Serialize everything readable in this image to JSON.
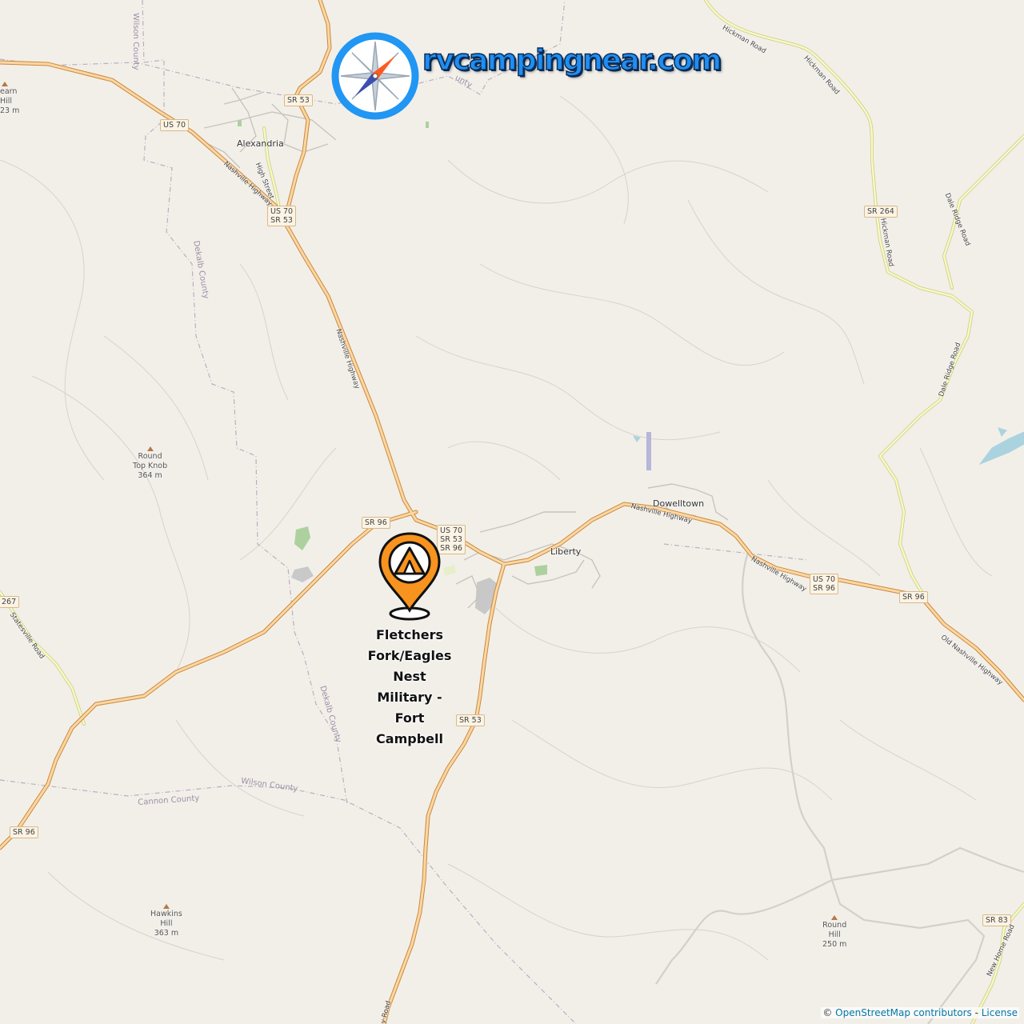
{
  "brand": {
    "text": "rvcampingnear.com",
    "icon": "compass-icon"
  },
  "marker": {
    "icon": "campground-pin-icon",
    "label_lines": [
      "Fletchers",
      "Fork/Eagles",
      "Nest",
      "Military -",
      "Fort",
      "Campbell"
    ],
    "color": "#f7931e"
  },
  "places": {
    "alexandria": "Alexandria",
    "dowelltown": "Dowelltown",
    "liberty": "Liberty"
  },
  "peaks": {
    "round_top_knob": [
      "Round",
      "Top Knob",
      "364 m"
    ],
    "hawkins_hill": [
      "Hawkins",
      "Hill",
      "363 m"
    ],
    "round_hill": [
      "Round",
      "Hill",
      "250 m"
    ],
    "edge_peak": [
      "earn",
      "Hill",
      "23 m"
    ]
  },
  "route_shields": {
    "us70_nw": [
      "US 70"
    ],
    "sr53_n": [
      "SR 53"
    ],
    "us70_sr53": [
      "US 70",
      "SR 53"
    ],
    "sr96_w": [
      "SR 96"
    ],
    "us70_sr53_sr96": [
      "US 70",
      "SR 53",
      "SR 96"
    ],
    "sr53_s": [
      "SR 53"
    ],
    "us70_sr96_e": [
      "US 70",
      "SR 96"
    ],
    "sr96_e": [
      "SR 96"
    ],
    "sr264": [
      "SR 264"
    ],
    "sr96_sw": [
      "SR 96"
    ],
    "sr83": [
      "SR 83"
    ],
    "sr267": [
      "267"
    ]
  },
  "road_labels": {
    "nashville_hwy_nw": "Nashville Highway",
    "high_street": "High Street",
    "nashville_hwy_mid": "Nashville Highway",
    "nashville_hwy_e1": "Nashville Highway",
    "nashville_hwy_e2": "Nashville Highway",
    "old_nashville_hwy": "Old Nashville Highway",
    "hickman_road_1": "Hickman Road",
    "hickman_road_2": "Hickman Road",
    "hickman_road_3": "Hickman Road",
    "dale_ridge_road_1": "Dale Ridge Road",
    "dale_ridge_road_2": "Dale Ridge Road",
    "statesville_road": "Statesville Road",
    "new_home_road": "New Home Road",
    "sr53_bottom": "y Road"
  },
  "boundary_labels": {
    "wilson_county_n": "Wilson County",
    "dekalb_county_n": "Dekalb County",
    "dekalb_county_s": "Dekalb County",
    "wilson_county_s": "Wilson County",
    "cannon_county": "Cannon County",
    "county_partial": "unty"
  },
  "attribution": {
    "prefix": "© ",
    "link": "OpenStreetMap contributors",
    "sep": " - ",
    "license": "License"
  }
}
